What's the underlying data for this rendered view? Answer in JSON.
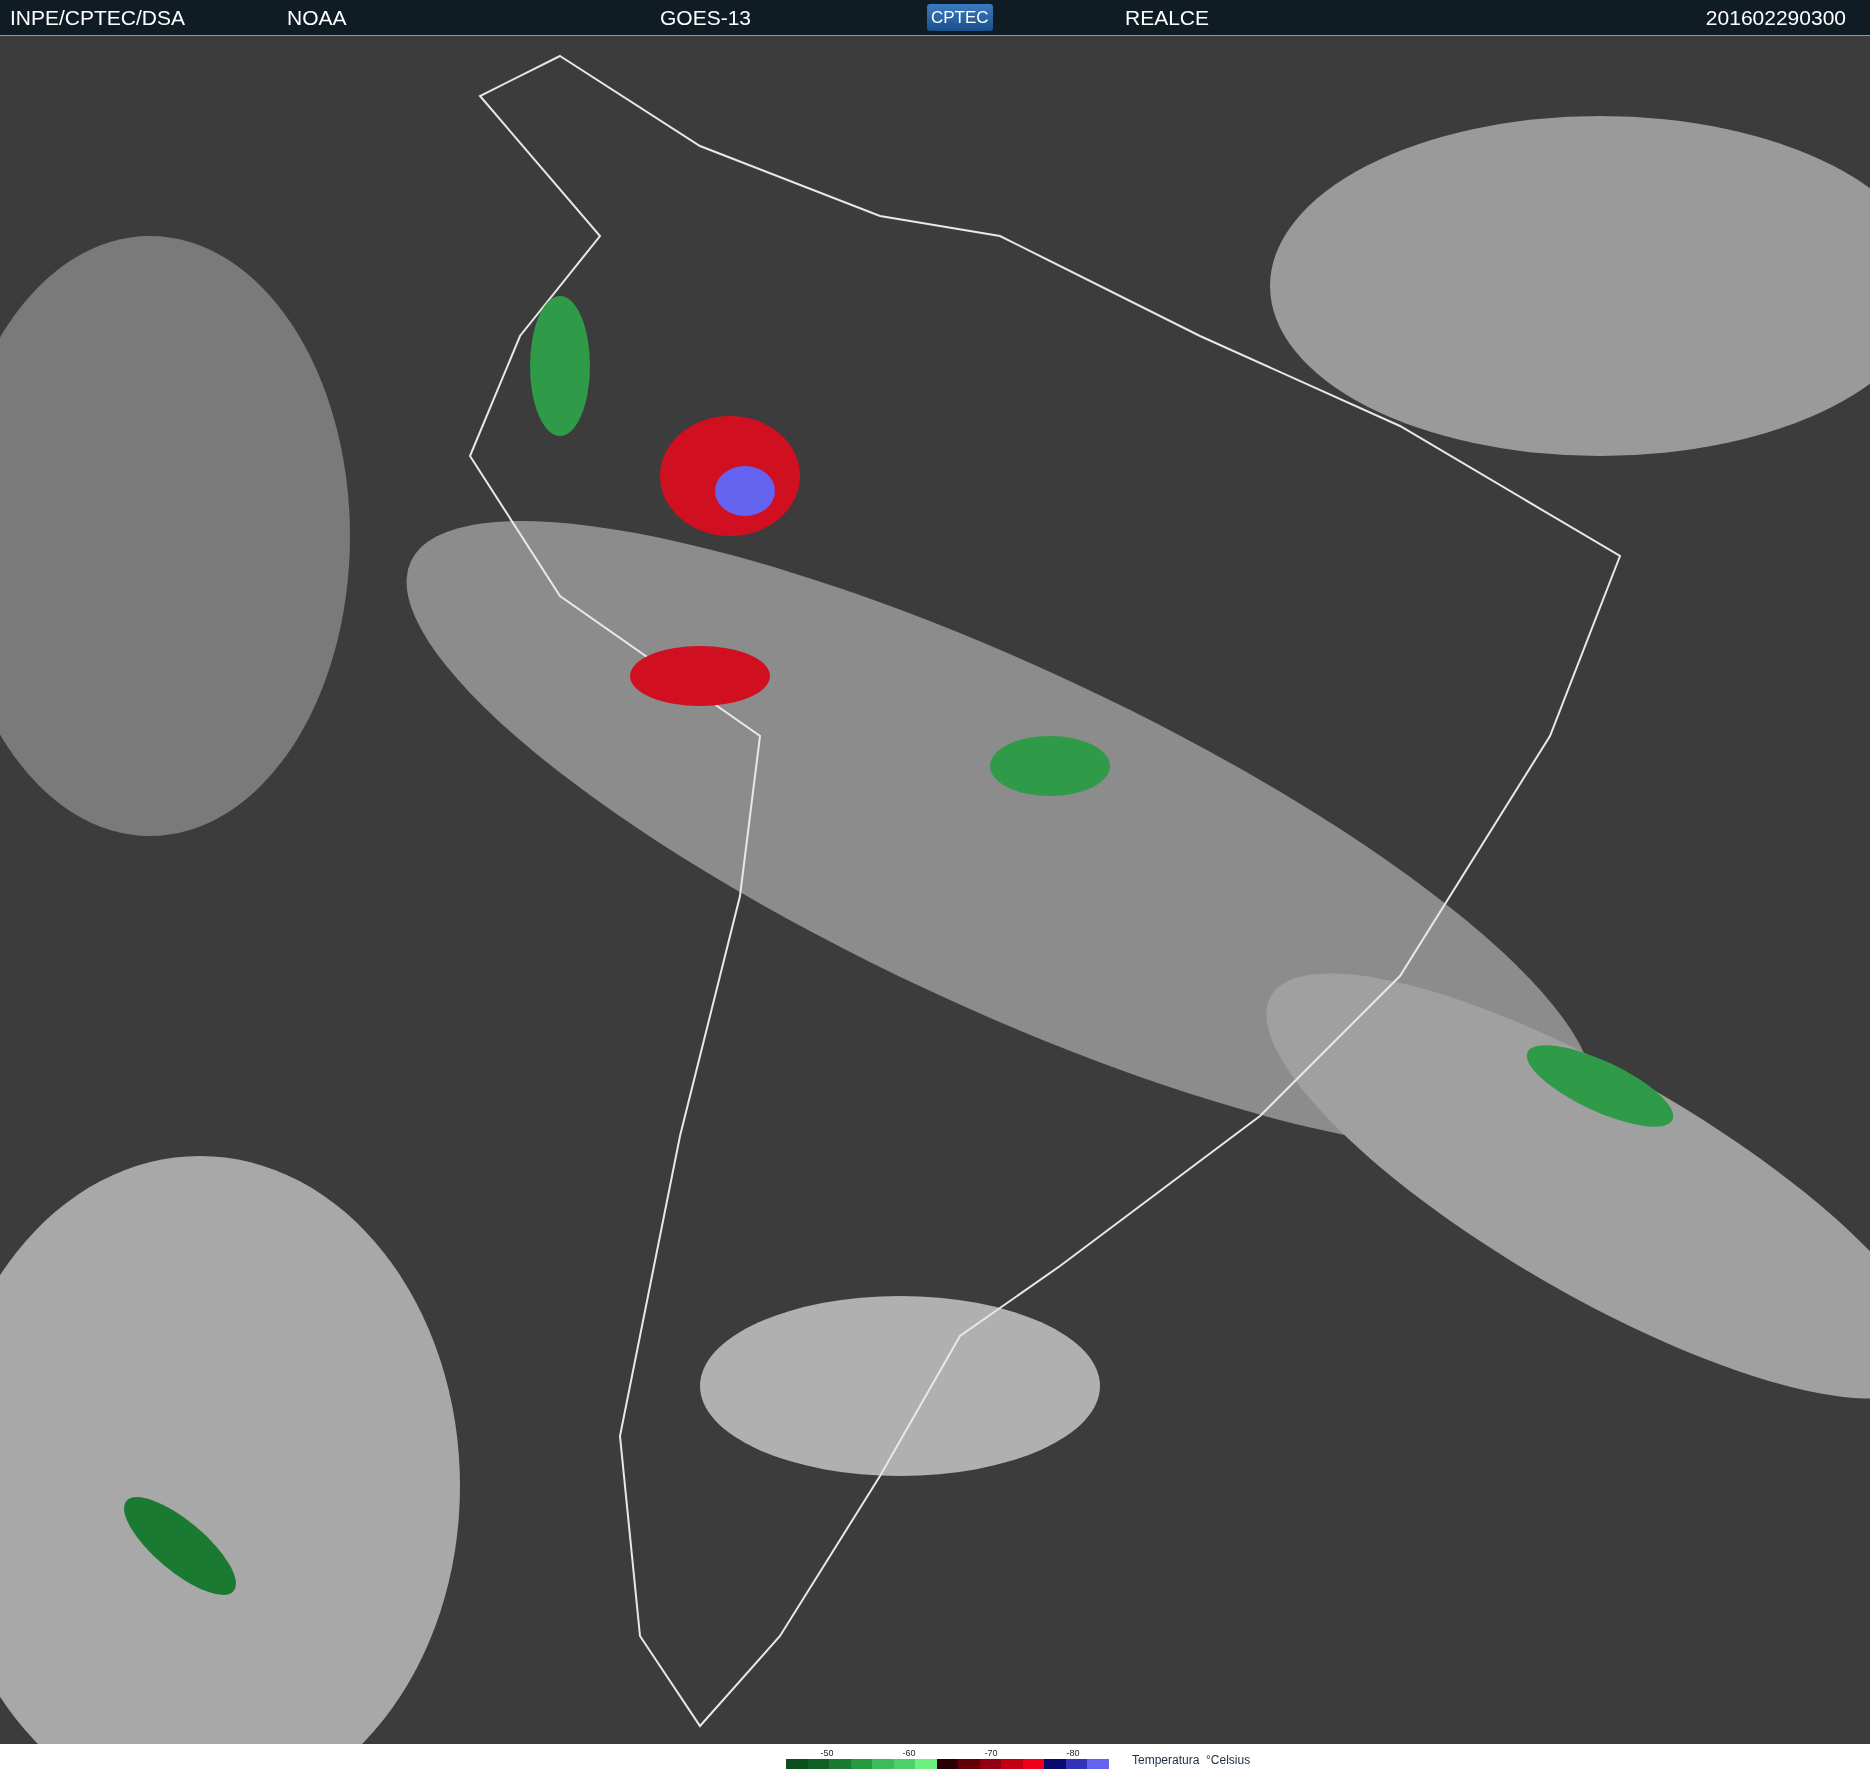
{
  "header": {
    "items": [
      {
        "kind": "text",
        "text": "INPE/CPTEC/DSA"
      },
      {
        "kind": "text",
        "text": "NOAA"
      },
      {
        "kind": "text",
        "text": "GOES-13"
      },
      {
        "kind": "logo",
        "text": "CPTEC"
      },
      {
        "kind": "text",
        "text": "REALCE"
      },
      {
        "kind": "text",
        "text": "201602290300"
      }
    ]
  },
  "legend": {
    "ticks": [
      "-50",
      "-60",
      "-70",
      "-80"
    ],
    "swatches": [
      {
        "color": "#0b4d1c"
      },
      {
        "color": "#115f25"
      },
      {
        "color": "#1a7a31"
      },
      {
        "color": "#279a41"
      },
      {
        "color": "#3dbb5a"
      },
      {
        "color": "#4dd06a"
      },
      {
        "color": "#6cf080"
      },
      {
        "color": "#2a0005"
      },
      {
        "color": "#640008"
      },
      {
        "color": "#900010"
      },
      {
        "color": "#c00010"
      },
      {
        "color": "#f00018"
      },
      {
        "color": "#0a0a6e"
      },
      {
        "color": "#3232b4"
      },
      {
        "color": "#6464f0"
      }
    ],
    "title": "Temperatura  °Celsius"
  }
}
